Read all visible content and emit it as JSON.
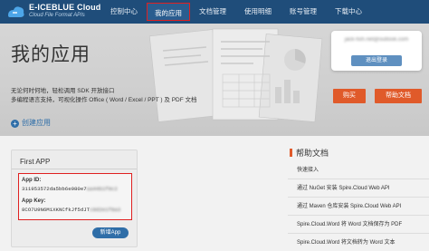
{
  "header": {
    "logo_title": "E-ICEBLUE Cloud",
    "logo_subtitle": "Cloud File Format APIs",
    "nav": [
      {
        "label": "控制中心",
        "active": false
      },
      {
        "label": "我的应用",
        "active": true
      },
      {
        "label": "文档管理",
        "active": false
      },
      {
        "label": "使用明细",
        "active": false
      },
      {
        "label": "账号管理",
        "active": false
      },
      {
        "label": "下载中心",
        "active": false
      }
    ]
  },
  "hero": {
    "title": "我的应用",
    "desc_line1": "无论何时何地，轻松调用 SDK 开放接口",
    "desc_line2": "多编程语言支持，可视化操作 Office ( Word / Excel / PPT ) 及 PDF 文档",
    "user_name": "jack-fish.net@outlook.com",
    "logout_label": "退出登录",
    "buy_label": "购买",
    "help_label": "帮助文档"
  },
  "create": {
    "label": "创建应用"
  },
  "app_card": {
    "title": "First APP",
    "app_id_label": "App ID:",
    "app_id_value": "311953572da5bb6e980e7",
    "app_id_hidden": "aa44b1f0c2",
    "app_key_label": "App Key:",
    "app_key_value": "8CO7U9N6M1XKNCfkJf5dJT",
    "app_key_hidden": "c9d2e1f8a3",
    "new_app_label": "新增App"
  },
  "help_docs": {
    "title": "帮助文档",
    "links": [
      "快速接入",
      "通过 NuGet 安装 Spire.Cloud Web API",
      "通过 Maven 仓库安装 Spire.Cloud Web API",
      "Spire.Cloud.Word 将 Word 文档保存为 PDF",
      "Spire.Cloud.Word 将文档转为 Word 文本"
    ]
  },
  "colors": {
    "nav_bg": "#1f4d7a",
    "accent_orange": "#e05a2a",
    "link_blue": "#2f6ea8",
    "highlight_red": "#e02020"
  }
}
